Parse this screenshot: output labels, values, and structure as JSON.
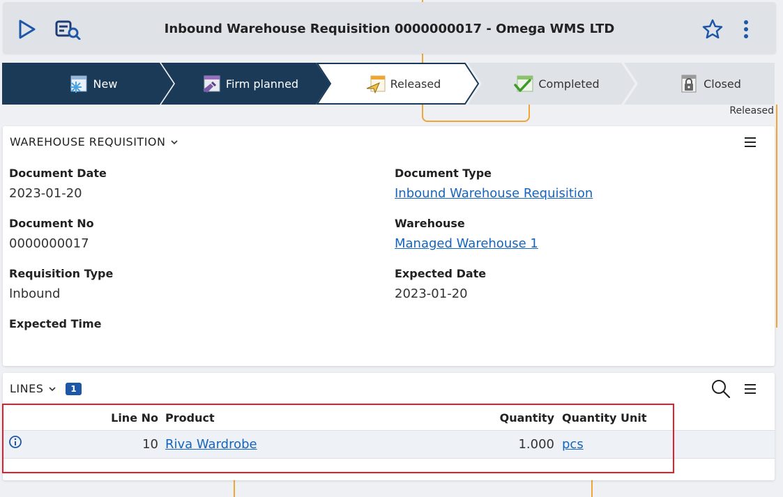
{
  "header": {
    "title": "Inbound Warehouse Requisition 0000000017 - Omega WMS LTD",
    "icons": [
      "play-icon",
      "document-search-icon",
      "star-icon",
      "more-vertical-icon"
    ]
  },
  "workflow": {
    "steps": [
      {
        "label": "New",
        "state": "done",
        "icon": "new-status-icon"
      },
      {
        "label": "Firm planned",
        "state": "done",
        "icon": "firm-planned-status-icon"
      },
      {
        "label": "Released",
        "state": "current",
        "icon": "released-status-icon"
      },
      {
        "label": "Completed",
        "state": "pending",
        "icon": "completed-status-icon"
      },
      {
        "label": "Closed",
        "state": "pending",
        "icon": "closed-status-icon"
      }
    ],
    "status_caption": "Released"
  },
  "requisition": {
    "section_title": "WAREHOUSE REQUISITION",
    "fields": {
      "document_date": {
        "label": "Document Date",
        "value": "2023-01-20"
      },
      "document_type": {
        "label": "Document Type",
        "value": "Inbound Warehouse Requisition"
      },
      "document_no": {
        "label": "Document No",
        "value": "0000000017"
      },
      "warehouse": {
        "label": "Warehouse",
        "value": "Managed Warehouse 1"
      },
      "requisition_type": {
        "label": "Requisition Type",
        "value": "Inbound"
      },
      "expected_date": {
        "label": "Expected Date",
        "value": "2023-01-20"
      },
      "expected_time": {
        "label": "Expected Time",
        "value": ""
      }
    }
  },
  "lines": {
    "section_title": "LINES",
    "count": "1",
    "columns": {
      "line_no": "Line No",
      "product": "Product",
      "quantity": "Quantity",
      "quantity_unit": "Quantity Unit"
    },
    "rows": [
      {
        "line_no": "10",
        "product": "Riva Wardrobe",
        "quantity": "1.000",
        "quantity_unit": "pcs"
      }
    ]
  },
  "colors": {
    "step_done_bg": "#1b3a57",
    "step_current_border": "#1b3a57",
    "step_pending_bg": "#dfe3e8",
    "link": "#1565c0",
    "badge": "#1e56a8",
    "highlight": "#e0202a",
    "background_line": "#f0a534"
  }
}
